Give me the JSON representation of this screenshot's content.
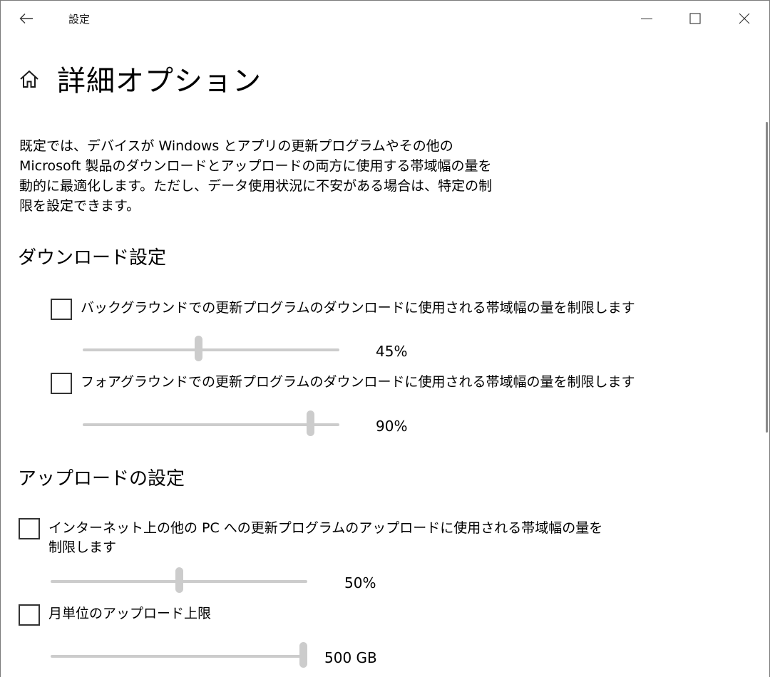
{
  "window": {
    "title": "設定"
  },
  "page": {
    "title": "詳細オプション",
    "description": "既定では、デバイスが Windows とアプリの更新プログラムやその他の Microsoft 製品のダウンロードとアップロードの両方に使用する帯域幅の量を動的に最適化します。ただし、データ使用状況に不安がある場合は、特定の制限を設定できます。"
  },
  "download": {
    "title": "ダウンロード設定",
    "background": {
      "label": "バックグラウンドでの更新プログラムのダウンロードに使用される帯域幅の量を制限します",
      "checked": false,
      "percent": 45,
      "value_text": "45%"
    },
    "foreground": {
      "label": "フォアグラウンドでの更新プログラムのダウンロードに使用される帯域幅の量を制限します",
      "checked": false,
      "percent": 90,
      "value_text": "90%"
    }
  },
  "upload": {
    "title": "アップロードの設定",
    "internet": {
      "label": "インターネット上の他の PC への更新プログラムのアップロードに使用される帯域幅の量を制限します",
      "checked": false,
      "percent": 50,
      "value_text": "50%"
    },
    "monthly": {
      "label": "月単位のアップロード上限",
      "checked": false,
      "fraction": 1.0,
      "value_text": "500 GB"
    }
  },
  "icons": {
    "back": "back-arrow-icon",
    "home": "home-icon",
    "minimize": "minimize-icon",
    "maximize": "maximize-icon",
    "close": "close-icon"
  },
  "colors": {
    "slider_track": "#cccccc",
    "slider_thumb": "#cccccc",
    "checkbox_border": "#333333"
  }
}
